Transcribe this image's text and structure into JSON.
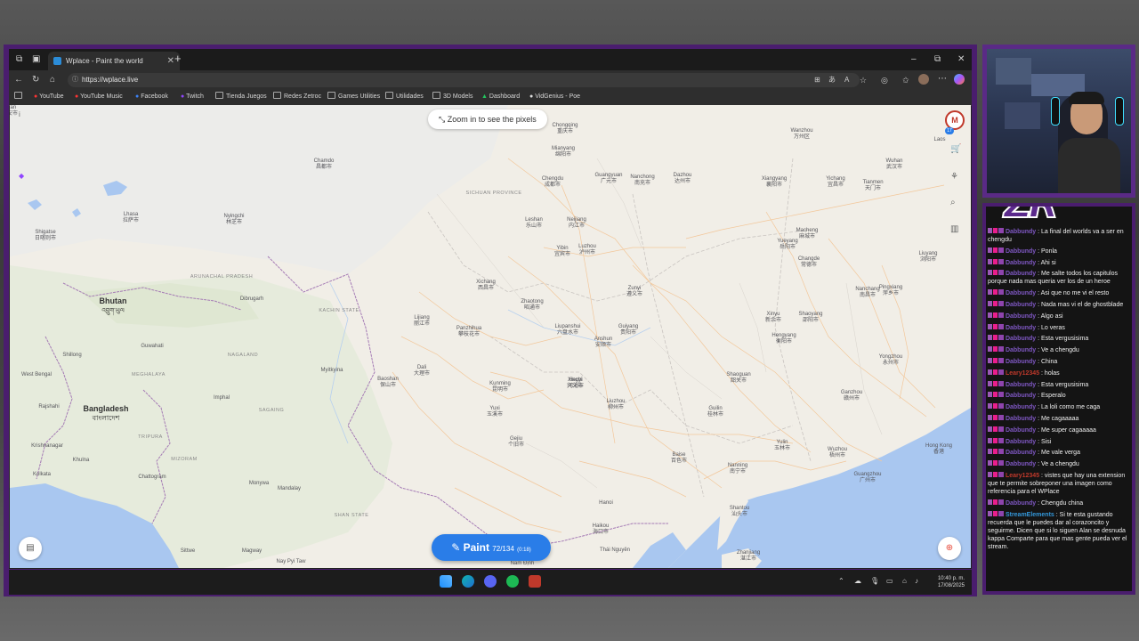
{
  "browser": {
    "tab_title": "Wplace - Paint the world",
    "new_tab": "+",
    "url": "https://wplace.live",
    "window_controls": {
      "minimize": "–",
      "restore": "⧉",
      "close": "✕"
    },
    "bookmarks": [
      "YouTube",
      "YouTube Music",
      "Facebook",
      "Twitch",
      "Tienda Juegos",
      "Redes Zetroc",
      "Games Utilities",
      "Utilidades",
      "3D Models",
      "Dashboard",
      "VidGenius - Poe"
    ]
  },
  "map": {
    "zoom_hint": "Zoom in to see the pixels",
    "paint_button": {
      "label": "Paint",
      "count": "72/134",
      "timer": "(0:18)"
    },
    "countries": [
      {
        "name": "Bhutan",
        "native": "འབྲུག་ཡུལ"
      },
      {
        "name": "Bangladesh",
        "native": "বাংলাদেশ"
      }
    ],
    "regions": [
      "ARUNACHAL PRADESH",
      "KACHIN STATE",
      "NAGALAND",
      "MEGHALAYA",
      "TRIPURA",
      "MIZORAM",
      "SAGAING",
      "SHAN STATE",
      "SICHUAN PROVINCE"
    ],
    "cities": [
      {
        "name": "Shigatse",
        "native": "日喀则市"
      },
      {
        "name": "Lhasa",
        "native": "拉萨市"
      },
      {
        "name": "Nyingchi",
        "native": "林芝市"
      },
      {
        "name": "Chamdo",
        "native": "昌都市"
      },
      {
        "name": "Dibrugarh",
        "native": ""
      },
      {
        "name": "Guwahati",
        "native": ""
      },
      {
        "name": "Shillong",
        "native": ""
      },
      {
        "name": "Imphal",
        "native": ""
      },
      {
        "name": "Myitkyina",
        "native": ""
      },
      {
        "name": "Rajshahi",
        "native": ""
      },
      {
        "name": "Khulna",
        "native": ""
      },
      {
        "name": "Krishnanagar",
        "native": ""
      },
      {
        "name": "Kolkata",
        "native": ""
      },
      {
        "name": "West Bengal",
        "native": ""
      },
      {
        "name": "Chattogram",
        "native": ""
      },
      {
        "name": "Monywa",
        "native": ""
      },
      {
        "name": "Mandalay",
        "native": ""
      },
      {
        "name": "Sittwe",
        "native": ""
      },
      {
        "name": "Magway",
        "native": ""
      },
      {
        "name": "Nay Pyi Taw",
        "native": ""
      },
      {
        "name": "Baoshan",
        "native": "保山市"
      },
      {
        "name": "Dali",
        "native": "大理市"
      },
      {
        "name": "Lijiang",
        "native": "丽江市"
      },
      {
        "name": "Panzhihua",
        "native": "攀枝花市"
      },
      {
        "name": "Xichang",
        "native": "西昌市"
      },
      {
        "name": "Kunming",
        "native": "昆明市"
      },
      {
        "name": "Yuxi",
        "native": "玉溪市"
      },
      {
        "name": "Gejiu",
        "native": "个旧市"
      },
      {
        "name": "Zhaotong",
        "native": "昭通市"
      },
      {
        "name": "Liupanshui",
        "native": "六盘水市"
      },
      {
        "name": "Anshun",
        "native": "安顺市"
      },
      {
        "name": "Guiyang",
        "native": "贵阳市"
      },
      {
        "name": "Xingyi",
        "native": "兴义市"
      },
      {
        "name": "Zunyi",
        "native": "遵义市"
      },
      {
        "name": "Yibin",
        "native": "宜宾市"
      },
      {
        "name": "Luzhou",
        "native": "泸州市"
      },
      {
        "name": "Leshan",
        "native": "乐山市"
      },
      {
        "name": "Neijiang",
        "native": "内江市"
      },
      {
        "name": "Chongqing",
        "native": "重庆市"
      },
      {
        "name": "Chengdu",
        "native": "成都市"
      },
      {
        "name": "Mianyang",
        "native": "绵阳市"
      },
      {
        "name": "Guangyuan",
        "native": "广元市"
      },
      {
        "name": "Nanchong",
        "native": "南充市"
      },
      {
        "name": "Dazhou",
        "native": "达州市"
      },
      {
        "name": "Wanzhou",
        "native": "万州区"
      },
      {
        "name": "Xiangyang",
        "native": "襄阳市"
      },
      {
        "name": "Yichang",
        "native": "宜昌市"
      },
      {
        "name": "Tianmen",
        "native": "天门市"
      },
      {
        "name": "Wuhan",
        "native": "武汉市"
      },
      {
        "name": "Macheng",
        "native": "麻城市"
      },
      {
        "name": "Yueyang",
        "native": "岳阳市"
      },
      {
        "name": "Changde",
        "native": "常德市"
      },
      {
        "name": "Liuyang",
        "native": "浏阳市"
      },
      {
        "name": "Nanchang",
        "native": "南昌市"
      },
      {
        "name": "Pingxiang",
        "native": "萍乡市"
      },
      {
        "name": "Xinyu",
        "native": "新余市"
      },
      {
        "name": "Shaoyang",
        "native": "邵阳市"
      },
      {
        "name": "Hengyang",
        "native": "衡阳市"
      },
      {
        "name": "Yongzhou",
        "native": "永州市"
      },
      {
        "name": "Ganzhou",
        "native": "赣州市"
      },
      {
        "name": "Shaoguan",
        "native": "韶关市"
      },
      {
        "name": "Guilin",
        "native": "桂林市"
      },
      {
        "name": "Liuzhou",
        "native": "柳州市"
      },
      {
        "name": "Hechi",
        "native": "河池市"
      },
      {
        "name": "Baise",
        "native": "百色市"
      },
      {
        "name": "Nanning",
        "native": "南宁市"
      },
      {
        "name": "Yulin",
        "native": "玉林市"
      },
      {
        "name": "Wuzhou",
        "native": "梧州市"
      },
      {
        "name": "Guangzhou",
        "native": "广州市"
      },
      {
        "name": "Hong Kong",
        "native": "香港"
      },
      {
        "name": "Shantou",
        "native": "汕头市"
      },
      {
        "name": "Zhanjiang",
        "native": "湛江市"
      },
      {
        "name": "Haikou",
        "native": "海口市"
      },
      {
        "name": "Hanoi",
        "native": ""
      },
      {
        "name": "Thái Nguyên",
        "native": ""
      },
      {
        "name": "Nam Định",
        "native": ""
      },
      {
        "name": "Laos",
        "native": ""
      },
      {
        "name": "Lu'an",
        "native": "六安市"
      }
    ]
  },
  "taskbar": {
    "time": "10:40 p. m.",
    "date": "17/08/2025"
  },
  "stream": {
    "logo": "ZR"
  },
  "chat": [
    {
      "user": "Dabbundy",
      "text": "La final del worlds va a ser en chengdu",
      "color": "#7e57c2"
    },
    {
      "user": "Dabbundy",
      "text": "Ponla",
      "color": "#7e57c2"
    },
    {
      "user": "Dabbundy",
      "text": "Ahi si",
      "color": "#7e57c2"
    },
    {
      "user": "Dabbundy",
      "text": "Me salte todos los capitulos porque nada mas queria ver los de un heroe",
      "color": "#7e57c2"
    },
    {
      "user": "Dabbundy",
      "text": "Asi que no me vi el resto",
      "color": "#7e57c2"
    },
    {
      "user": "Dabbundy",
      "text": "Nada mas vi el de ghostblade",
      "color": "#7e57c2"
    },
    {
      "user": "Dabbundy",
      "text": "Algo asi",
      "color": "#7e57c2"
    },
    {
      "user": "Dabbundy",
      "text": "Lo veras",
      "color": "#7e57c2"
    },
    {
      "user": "Dabbundy",
      "text": "Esta vergusisima",
      "color": "#7e57c2"
    },
    {
      "user": "Dabbundy",
      "text": "Ve a chengdu",
      "color": "#7e57c2"
    },
    {
      "user": "Dabbundy",
      "text": "China",
      "color": "#7e57c2"
    },
    {
      "user": "Leary12345",
      "text": "holas",
      "color": "#c0392b"
    },
    {
      "user": "Dabbundy",
      "text": "Esta vergusisima",
      "color": "#7e57c2"
    },
    {
      "user": "Dabbundy",
      "text": "Esperalo",
      "color": "#7e57c2"
    },
    {
      "user": "Dabbundy",
      "text": "La loli como me caga",
      "color": "#7e57c2"
    },
    {
      "user": "Dabbundy",
      "text": "Me cagaaaaa",
      "color": "#7e57c2"
    },
    {
      "user": "Dabbundy",
      "text": "Me super cagaaaaa",
      "color": "#7e57c2"
    },
    {
      "user": "Dabbundy",
      "text": "Sisi",
      "color": "#7e57c2"
    },
    {
      "user": "Dabbundy",
      "text": "Me vale verga",
      "color": "#7e57c2"
    },
    {
      "user": "Dabbundy",
      "text": "Ve a chengdu",
      "color": "#7e57c2"
    },
    {
      "user": "Leary12345",
      "text": "vistes que hay una extension que te permite sobreponer una imagen como referencia para el WPlace",
      "color": "#c0392b"
    },
    {
      "user": "Dabbundy",
      "text": "Chengdu china",
      "color": "#7e57c2"
    },
    {
      "user": "StreamElements",
      "text": "Si te esta gustando recuerda que le puedes dar al corazoncito y seguirme. Dicen que si lo siguen Alan se desnuda kappa Comparte para que mas gente pueda ver el stream.",
      "color": "#3498db"
    }
  ]
}
